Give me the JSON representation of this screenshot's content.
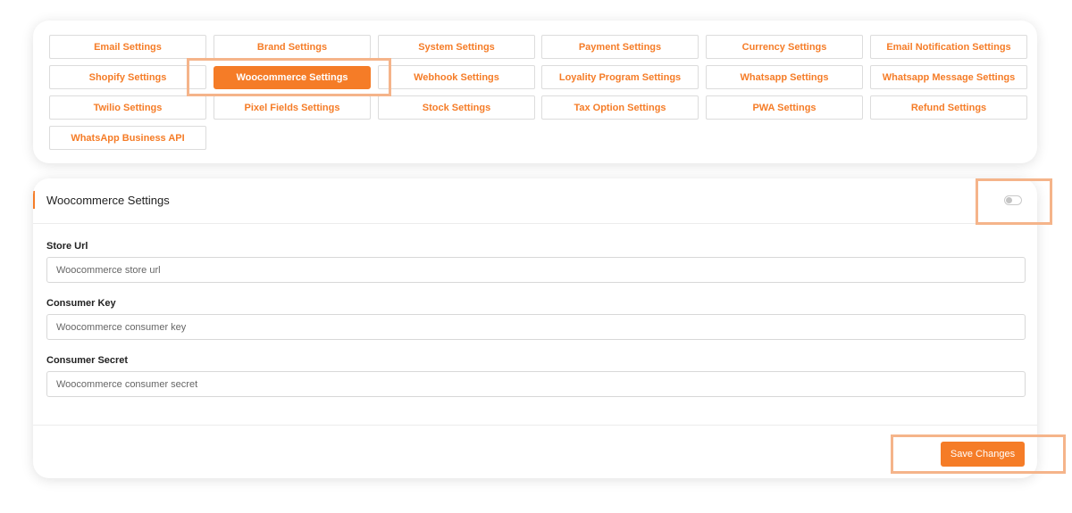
{
  "tabs": [
    {
      "label": "Email Settings",
      "active": false
    },
    {
      "label": "Brand Settings",
      "active": false
    },
    {
      "label": "System Settings",
      "active": false
    },
    {
      "label": "Payment Settings",
      "active": false
    },
    {
      "label": "Currency Settings",
      "active": false
    },
    {
      "label": "Email Notification Settings",
      "active": false
    },
    {
      "label": "Shopify Settings",
      "active": false
    },
    {
      "label": "Woocommerce Settings",
      "active": true
    },
    {
      "label": "Webhook Settings",
      "active": false
    },
    {
      "label": "Loyality Program Settings",
      "active": false
    },
    {
      "label": "Whatsapp Settings",
      "active": false
    },
    {
      "label": "Whatsapp Message Settings",
      "active": false
    },
    {
      "label": "Twilio Settings",
      "active": false
    },
    {
      "label": "Pixel Fields Settings",
      "active": false
    },
    {
      "label": "Stock Settings",
      "active": false
    },
    {
      "label": "Tax Option Settings",
      "active": false
    },
    {
      "label": "PWA Settings",
      "active": false
    },
    {
      "label": "Refund Settings",
      "active": false
    },
    {
      "label": "WhatsApp Business API",
      "active": false
    }
  ],
  "form": {
    "title": "Woocommerce Settings",
    "enabled": false,
    "fields": [
      {
        "label": "Store Url",
        "placeholder": "Woocommerce store url",
        "value": ""
      },
      {
        "label": "Consumer Key",
        "placeholder": "Woocommerce consumer key",
        "value": ""
      },
      {
        "label": "Consumer Secret",
        "placeholder": "Woocommerce consumer secret",
        "value": ""
      }
    ],
    "save_label": "Save Changes"
  },
  "colors": {
    "accent": "#f57c27",
    "highlight": "#f5b48a",
    "border": "#dcdcdc"
  }
}
